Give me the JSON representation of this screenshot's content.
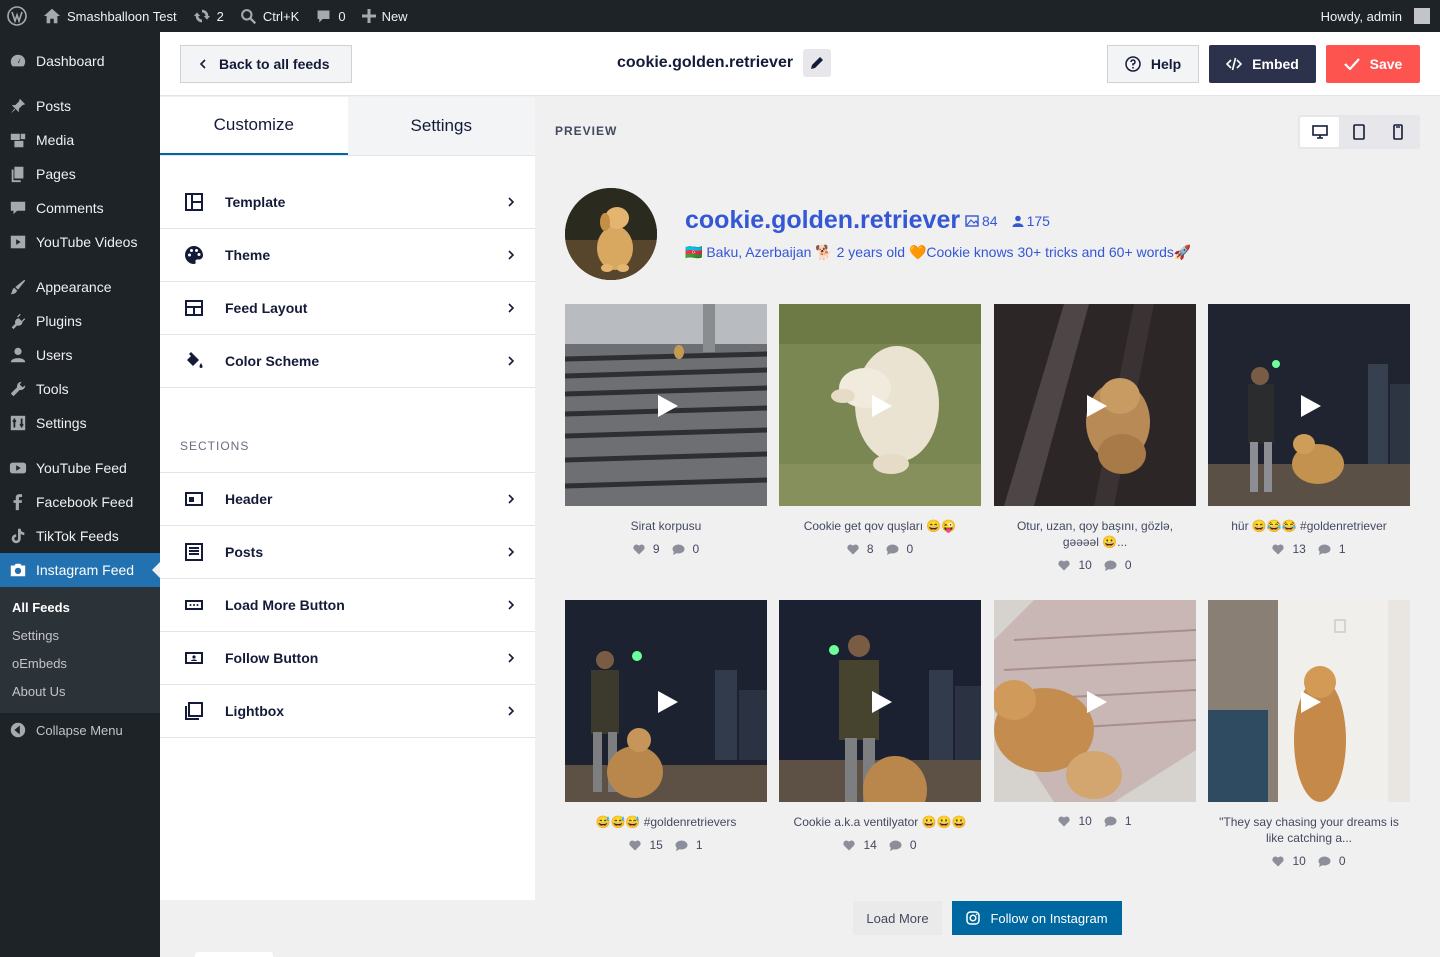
{
  "adminbar": {
    "site_name": "Smashballoon Test",
    "updates_count": "2",
    "search_shortcut": "Ctrl+K",
    "comments_count": "0",
    "new_label": "New",
    "greeting": "Howdy, admin"
  },
  "sidebar": {
    "items": [
      {
        "label": "Dashboard",
        "icon": "dashboard-icon"
      },
      {
        "label": "Posts",
        "icon": "pin-icon"
      },
      {
        "label": "Media",
        "icon": "media-icon"
      },
      {
        "label": "Pages",
        "icon": "pages-icon"
      },
      {
        "label": "Comments",
        "icon": "comment-icon"
      },
      {
        "label": "YouTube Videos",
        "icon": "video-icon"
      },
      {
        "label": "Appearance",
        "icon": "brush-icon"
      },
      {
        "label": "Plugins",
        "icon": "plug-icon"
      },
      {
        "label": "Users",
        "icon": "user-icon"
      },
      {
        "label": "Tools",
        "icon": "wrench-icon"
      },
      {
        "label": "Settings",
        "icon": "settings-icon"
      },
      {
        "label": "YouTube Feed",
        "icon": "youtube-icon"
      },
      {
        "label": "Facebook Feed",
        "icon": "facebook-icon"
      },
      {
        "label": "TikTok Feeds",
        "icon": "tiktok-icon"
      },
      {
        "label": "Instagram Feed",
        "icon": "camera-icon"
      }
    ],
    "submenu": [
      "All Feeds",
      "Settings",
      "oEmbeds",
      "About Us"
    ],
    "collapse_label": "Collapse Menu"
  },
  "header": {
    "back_label": "Back to all feeds",
    "feed_name": "cookie.golden.retriever",
    "help_label": "Help",
    "embed_label": "Embed",
    "save_label": "Save"
  },
  "panel": {
    "tabs": [
      "Customize",
      "Settings"
    ],
    "items": [
      "Template",
      "Theme",
      "Feed Layout",
      "Color Scheme"
    ],
    "sections_label": "SECTIONS",
    "sections": [
      "Header",
      "Posts",
      "Load More Button",
      "Follow Button",
      "Lightbox"
    ]
  },
  "preview": {
    "label": "PREVIEW",
    "username": "cookie.golden.retriever",
    "posts_count": "84",
    "followers_count": "175",
    "bio": "🇦🇿 Baku, Azerbaijan 🐕 2 years old 🧡Cookie knows 30+ tricks and 60+ words🚀",
    "posts": [
      {
        "caption": "Sirat korpusu",
        "likes": "9",
        "comments": "0"
      },
      {
        "caption": "Cookie get qov quşları 😄😜",
        "likes": "8",
        "comments": "0"
      },
      {
        "caption": "Otur, uzan, qoy başını, gözlə, gəəəəl 😀...",
        "likes": "10",
        "comments": "0"
      },
      {
        "caption": "hür 😄😂😂 #goldenretriever",
        "likes": "13",
        "comments": "1"
      },
      {
        "caption": "😅😅😅 #goldenretrievers",
        "likes": "15",
        "comments": "1"
      },
      {
        "caption": "Cookie a.k.a ventilyator 😀😀😀",
        "likes": "14",
        "comments": "0"
      },
      {
        "caption": "",
        "likes": "10",
        "comments": "1"
      },
      {
        "caption": "\"They say chasing your dreams is like catching a...",
        "likes": "10",
        "comments": "0"
      }
    ],
    "load_more_label": "Load More",
    "follow_label": "Follow on Instagram"
  }
}
